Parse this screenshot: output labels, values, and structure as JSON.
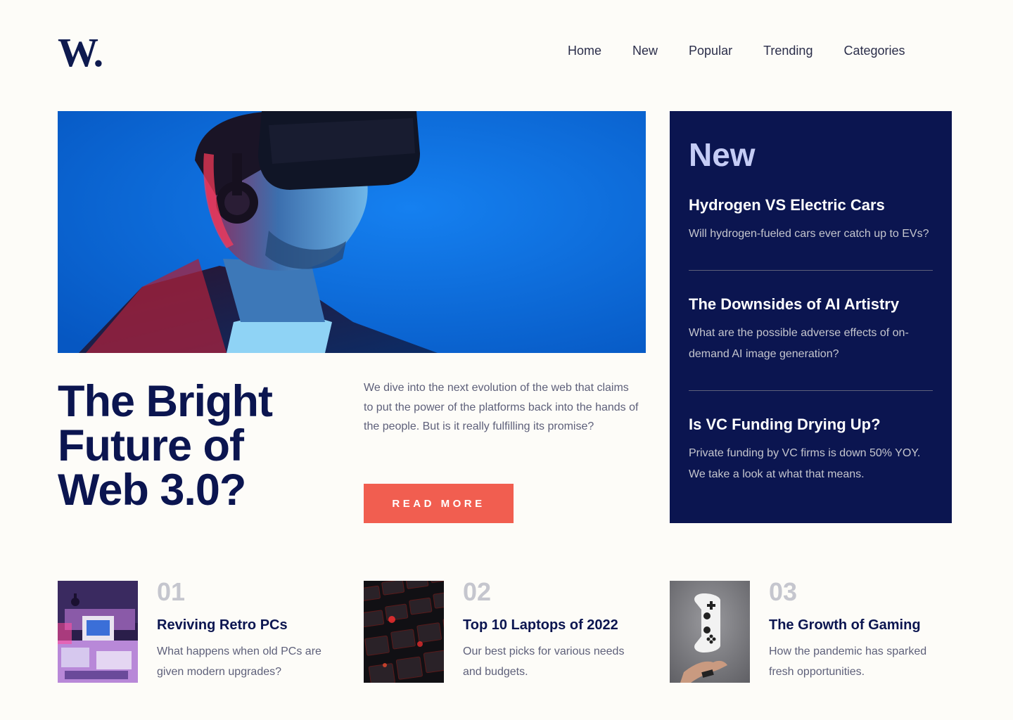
{
  "header": {
    "logo": "W.",
    "nav": [
      "Home",
      "New",
      "Popular",
      "Trending",
      "Categories"
    ]
  },
  "hero": {
    "title": "The Bright Future of Web 3.0?",
    "description": "We dive into the next evolution of the web that claims to put the power of the platforms back into the hands of the people. But is it really fulfilling its promise?",
    "button_label": "READ MORE"
  },
  "new_panel": {
    "heading": "New",
    "items": [
      {
        "title": "Hydrogen VS Electric Cars",
        "desc": "Will hydrogen-fueled cars ever catch up to EVs?"
      },
      {
        "title": "The Downsides of AI Artistry",
        "desc": "What are the possible adverse effects of on-demand AI image generation?"
      },
      {
        "title": "Is VC Funding Drying Up?",
        "desc": "Private funding by VC firms is down 50% YOY. We take a look at what that means."
      }
    ]
  },
  "cards": [
    {
      "number": "01",
      "title": "Reviving Retro PCs",
      "desc": "What happens when old PCs are given modern upgrades?"
    },
    {
      "number": "02",
      "title": "Top 10 Laptops of 2022",
      "desc": "Our best picks for various needs and budgets."
    },
    {
      "number": "03",
      "title": "The Growth of Gaming",
      "desc": "How the pandemic has sparked fresh opportunities."
    }
  ],
  "colors": {
    "dark_blue": "#0B1550",
    "accent_red": "#F15E50",
    "background": "#FDFCF8",
    "grayish_blue": "#5E607A",
    "new_heading": "#C5CCF5"
  }
}
